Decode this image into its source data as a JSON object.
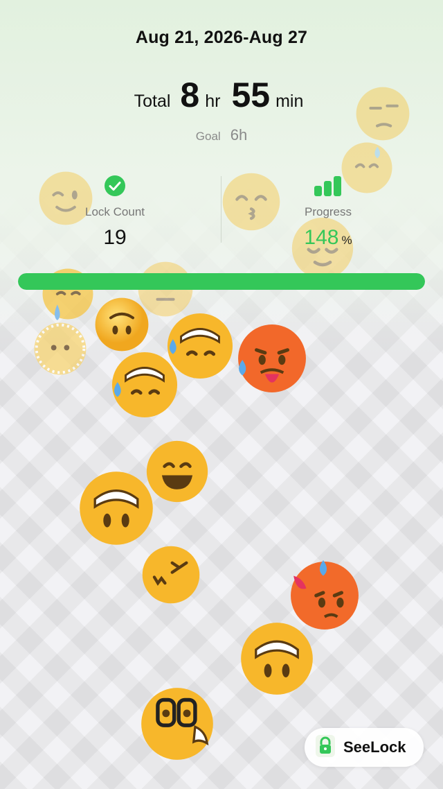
{
  "header": {
    "date_range": "Aug 21, 2026-Aug 27",
    "total_label": "Total",
    "hours": "8",
    "hours_unit": "hr",
    "minutes": "55",
    "minutes_unit": "min",
    "goal_label": "Goal",
    "goal_value": "6h"
  },
  "stats": {
    "lock_count_label": "Lock Count",
    "lock_count_value": "19",
    "progress_label": "Progress",
    "progress_value": "148",
    "progress_unit": "%"
  },
  "progress_bar": {
    "fraction": 1.0,
    "color": "#34c759"
  },
  "brand": {
    "name": "SeeLock",
    "icon": "lock-icon"
  },
  "colors": {
    "accent_green": "#34c759",
    "emoji_yellow": "#f7b72b",
    "hot_orange": "#f2682a"
  }
}
